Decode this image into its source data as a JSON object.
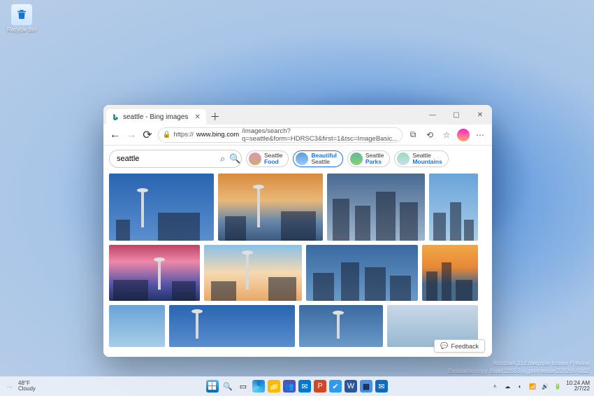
{
  "desktop": {
    "recycle_bin": "Recycle Bin"
  },
  "watermark": {
    "line1": "Windows 11 Enterprise Insider Preview",
    "line2": "Evaluation copy. Build 22553.ni_prerelease.220205-0102"
  },
  "browser": {
    "tab_title": "seattle - Bing images",
    "url_display_pre": "https://",
    "url_host": "www.bing.com",
    "url_rest": "/images/search?q=seattle&form=HDRSC3&first=1&tsc=ImageBasic...",
    "search_value": "seattle",
    "suggestions": [
      {
        "line1": "Seattle",
        "line2": "Food"
      },
      {
        "line1": "Beautiful",
        "line2": "Seattle"
      },
      {
        "line1": "Seattle",
        "line2": "Parks"
      },
      {
        "line1": "Seattle",
        "line2": "Mountains"
      }
    ],
    "feedback_label": "Feedback"
  },
  "taskbar": {
    "weather_temp": "48°F",
    "weather_desc": "Cloudy",
    "time": "10:24 AM",
    "date": "2/7/22"
  }
}
